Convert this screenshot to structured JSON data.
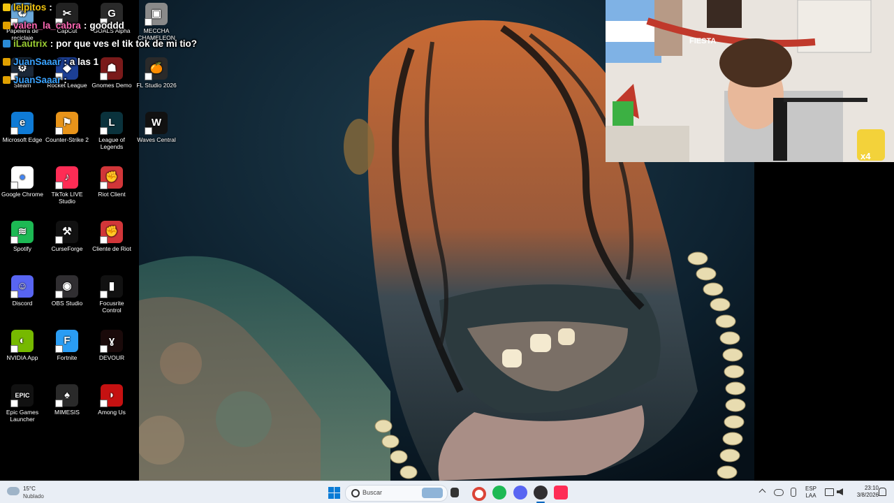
{
  "chat": {
    "lines": [
      {
        "user": "lelpitos",
        "sep": ":",
        "text": ""
      },
      {
        "user": "valen_la_cabra",
        "sep": ":",
        "text": "gooddd"
      },
      {
        "user": "iLautrix",
        "sep": ":",
        "text": "por que ves el tik tok de mi tio?"
      },
      {
        "user": "JuanSaaar",
        "sep": ":",
        "text": "a las 1"
      },
      {
        "user": "JuanSaaar",
        "sep": ":",
        "text": ""
      }
    ],
    "colors": {
      "lelpitos": "#f1c40f",
      "valen_la_cabra": "#ff69b4",
      "iLautrix": "#9acd32",
      "JuanSaaar": "#3aa3ff"
    }
  },
  "desktop": {
    "icons": [
      {
        "label": "Papelera de reciclaje",
        "icon": "recycle-bin-icon",
        "color": "#6aa7d8"
      },
      {
        "label": "CapCut",
        "icon": "capcut-icon",
        "color": "#222222"
      },
      {
        "label": "GOALS Alpha",
        "icon": "goals-icon",
        "color": "#2a2a2a"
      },
      {
        "label": "MECCHA CHAMELEON",
        "icon": "meccha-icon",
        "color": "#8a8a8a"
      },
      {
        "label": "Steam",
        "icon": "steam-icon",
        "color": "#1b2838"
      },
      {
        "label": "Rocket League",
        "icon": "rocket-league-icon",
        "color": "#1c3f94"
      },
      {
        "label": "Gnomes Demo",
        "icon": "gnomes-icon",
        "color": "#7a1a1a"
      },
      {
        "label": "FL Studio 2026",
        "icon": "fl-studio-icon",
        "color": "#2a2a2a"
      },
      {
        "label": "Microsoft Edge",
        "icon": "edge-icon",
        "color": "#0f7bd6"
      },
      {
        "label": "Counter-Strike 2",
        "icon": "cs2-icon",
        "color": "#e8941a"
      },
      {
        "label": "League of Legends",
        "icon": "lol-icon",
        "color": "#0a323c"
      },
      {
        "label": "Waves Central",
        "icon": "waves-icon",
        "color": "#111111"
      },
      {
        "label": "Google Chrome",
        "icon": "chrome-icon",
        "color": "#ffffff"
      },
      {
        "label": "TikTok LIVE Studio",
        "icon": "tiktok-live-icon",
        "color": "#fe2c55"
      },
      {
        "label": "Riot Client",
        "icon": "riot-client-icon",
        "color": "#d13639"
      },
      {
        "label": "Spotify",
        "icon": "spotify-icon",
        "color": "#1db954"
      },
      {
        "label": "CurseForge",
        "icon": "curseforge-icon",
        "color": "#111111"
      },
      {
        "label": "Cliente de Riot",
        "icon": "riot-icon",
        "color": "#d13639"
      },
      {
        "label": "Discord",
        "icon": "discord-icon",
        "color": "#5865f2"
      },
      {
        "label": "OBS Studio",
        "icon": "obs-icon",
        "color": "#302e31"
      },
      {
        "label": "Focusrite Control",
        "icon": "focusrite-icon",
        "color": "#111111"
      },
      {
        "label": "NVIDIA App",
        "icon": "nvidia-icon",
        "color": "#76b900"
      },
      {
        "label": "Fortnite",
        "icon": "fortnite-icon",
        "color": "#2a9df4"
      },
      {
        "label": "DEVOUR",
        "icon": "devour-icon",
        "color": "#1a0a0a"
      },
      {
        "label": "Epic Games Launcher",
        "icon": "epic-icon",
        "color": "#111111"
      },
      {
        "label": "MIMESIS",
        "icon": "mimesis-icon",
        "color": "#2a2a2a"
      },
      {
        "label": "Among Us",
        "icon": "among-us-icon",
        "color": "#c51111"
      }
    ],
    "glyphs": {
      "steam": "⚙",
      "edge": "e",
      "chrome": "●",
      "spotify": "≋",
      "discord": "☺",
      "obs": "◉",
      "nvidia": "◐",
      "epic": "EPIC",
      "fortnite": "F",
      "riot": "✊",
      "cs2": "⚑",
      "lol": "L",
      "waves": "W",
      "tiktok": "♪",
      "fl": "🍊",
      "capcut": "✂",
      "goals": "G",
      "curse": "⚒",
      "focus": "▮",
      "devour": "ɣ",
      "mimesis": "♠",
      "among": "◗",
      "gnomes": "☗",
      "meccha": "▣",
      "rocket": "◆",
      "recycle": "♻"
    }
  },
  "webcam": {
    "banner": "FIESTA",
    "counter": "x4"
  },
  "taskbar": {
    "weather_temp": "15°C",
    "weather_desc": "Nublado",
    "search_placeholder": "Buscar",
    "lang_top": "ESP",
    "lang_bottom": "LAA",
    "time": "23:10",
    "date": "3/8/2026"
  },
  "colors": {
    "taskbar_bg": "#e9eef5",
    "accent": "#0067c0"
  }
}
